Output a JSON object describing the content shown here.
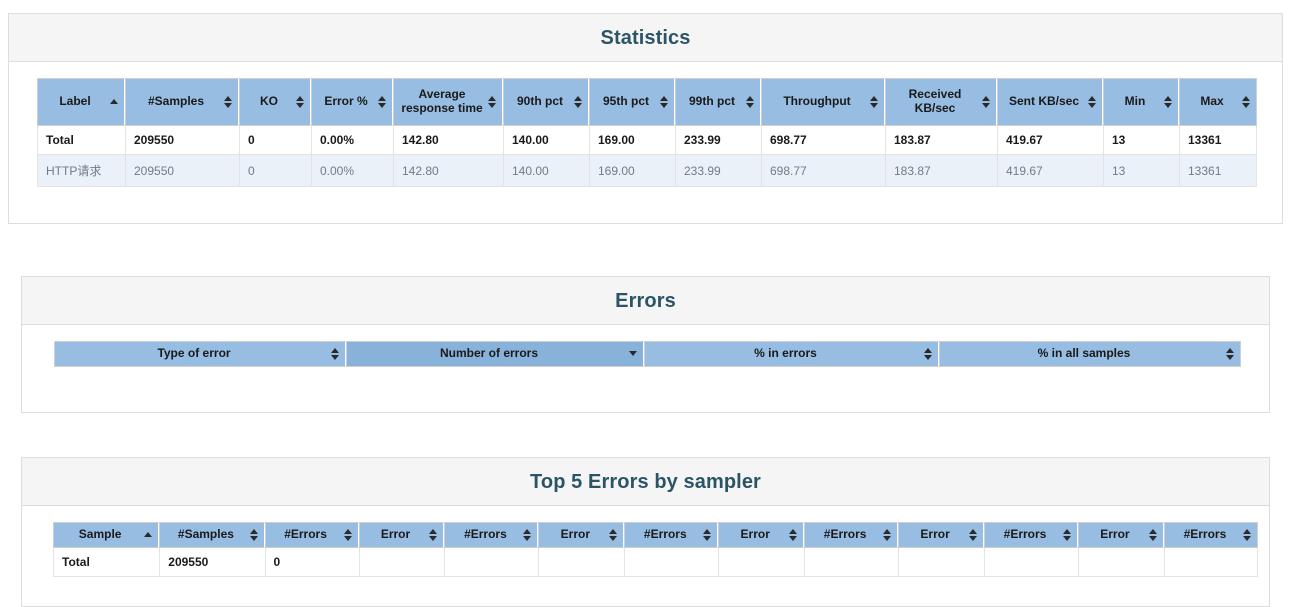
{
  "theme": {
    "title_color": "#2b5566",
    "header_blue": "#97bde2",
    "header_blue_sorted": "#89b2db",
    "row_alt_blue": "#eaf1f9",
    "panel_heading_bg": "#f5f5f5",
    "panel_border": "#dddddd"
  },
  "statistics": {
    "title": "Statistics",
    "columns": [
      {
        "label": "Label",
        "sort": "asc"
      },
      {
        "label": "#Samples",
        "sort": "both"
      },
      {
        "label": "KO",
        "sort": "both"
      },
      {
        "label": "Error %",
        "sort": "both"
      },
      {
        "label": "Average\nresponse time",
        "line1": "Average",
        "line2": "response time",
        "sort": "both"
      },
      {
        "label": "90th pct",
        "sort": "both"
      },
      {
        "label": "95th pct",
        "sort": "both"
      },
      {
        "label": "99th pct",
        "sort": "both"
      },
      {
        "label": "Throughput",
        "sort": "both"
      },
      {
        "label": "Received\nKB/sec",
        "line1": "Received",
        "line2": "KB/sec",
        "sort": "both"
      },
      {
        "label": "Sent KB/sec",
        "sort": "both"
      },
      {
        "label": "Min",
        "sort": "both"
      },
      {
        "label": "Max",
        "sort": "both"
      }
    ],
    "rows": [
      {
        "type": "total",
        "cells": [
          "Total",
          "209550",
          "0",
          "0.00%",
          "142.80",
          "140.00",
          "169.00",
          "233.99",
          "698.77",
          "183.87",
          "419.67",
          "13",
          "13361"
        ]
      },
      {
        "type": "data",
        "cells": [
          "HTTP请求",
          "209550",
          "0",
          "0.00%",
          "142.80",
          "140.00",
          "169.00",
          "233.99",
          "698.77",
          "183.87",
          "419.67",
          "13",
          "13361"
        ]
      }
    ]
  },
  "errors": {
    "title": "Errors",
    "columns": [
      {
        "label": "Type of error",
        "sort": "both"
      },
      {
        "label": "Number of errors",
        "sort": "desc"
      },
      {
        "label": "% in errors",
        "sort": "both"
      },
      {
        "label": "% in all samples",
        "sort": "both"
      }
    ],
    "rows": []
  },
  "top5": {
    "title": "Top 5 Errors by sampler",
    "columns": [
      {
        "label": "Sample",
        "sort": "asc"
      },
      {
        "label": "#Samples",
        "sort": "both"
      },
      {
        "label": "#Errors",
        "sort": "both"
      },
      {
        "label": "Error",
        "sort": "both"
      },
      {
        "label": "#Errors",
        "sort": "both"
      },
      {
        "label": "Error",
        "sort": "both"
      },
      {
        "label": "#Errors",
        "sort": "both"
      },
      {
        "label": "Error",
        "sort": "both"
      },
      {
        "label": "#Errors",
        "sort": "both"
      },
      {
        "label": "Error",
        "sort": "both"
      },
      {
        "label": "#Errors",
        "sort": "both"
      },
      {
        "label": "Error",
        "sort": "both"
      },
      {
        "label": "#Errors",
        "sort": "both"
      }
    ],
    "rows": [
      {
        "type": "total",
        "cells": [
          "Total",
          "209550",
          "0",
          "",
          "",
          "",
          "",
          "",
          "",
          "",
          "",
          "",
          ""
        ]
      }
    ]
  }
}
